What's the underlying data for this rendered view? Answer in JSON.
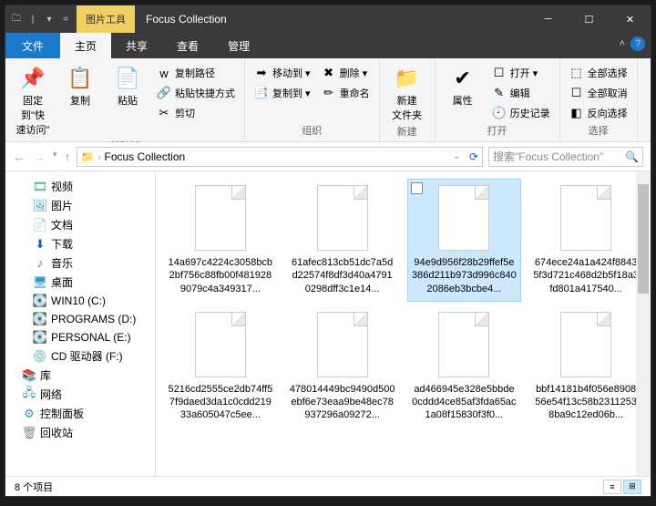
{
  "titlebar": {
    "contextual_label": "图片工具",
    "title": "Focus Collection"
  },
  "tabs": {
    "file": "文件",
    "items": [
      "主页",
      "共享",
      "查看",
      "管理"
    ],
    "active": 0
  },
  "ribbon": {
    "groups": [
      {
        "label": "剪贴板",
        "big": [
          {
            "label": "固定到\"快\n速访问\"",
            "icon": "📌"
          },
          {
            "label": "复制",
            "icon": "📋"
          },
          {
            "label": "粘贴",
            "icon": "📄"
          }
        ],
        "small": [
          {
            "label": "复制路径",
            "icon": "w"
          },
          {
            "label": "粘贴快捷方式",
            "icon": "🔗"
          },
          {
            "label": "剪切",
            "icon": "✂"
          }
        ]
      },
      {
        "label": "组织",
        "small": [
          {
            "label": "移动到 ▾",
            "icon": "➡"
          },
          {
            "label": "复制到 ▾",
            "icon": "📑"
          }
        ],
        "small2": [
          {
            "label": "删除 ▾",
            "icon": "✖"
          },
          {
            "label": "重命名",
            "icon": "✏"
          }
        ]
      },
      {
        "label": "新建",
        "big": [
          {
            "label": "新建\n文件夹",
            "icon": "📁"
          }
        ]
      },
      {
        "label": "打开",
        "big": [
          {
            "label": "属性",
            "icon": "✔"
          }
        ],
        "small": [
          {
            "label": "打开 ▾",
            "icon": "☐"
          },
          {
            "label": "编辑",
            "icon": "✎"
          },
          {
            "label": "历史记录",
            "icon": "🕘"
          }
        ]
      },
      {
        "label": "选择",
        "small": [
          {
            "label": "全部选择",
            "icon": "⬚"
          },
          {
            "label": "全部取消",
            "icon": "☐"
          },
          {
            "label": "反向选择",
            "icon": "◧"
          }
        ]
      }
    ]
  },
  "addressbar": {
    "path": "Focus Collection",
    "search_placeholder": "搜索\"Focus Collection\""
  },
  "sidebar": [
    {
      "label": "视频",
      "icon": "🎞",
      "color": "#4a8"
    },
    {
      "label": "图片",
      "icon": "🖼",
      "color": "#39c"
    },
    {
      "label": "文档",
      "icon": "📄",
      "color": "#888"
    },
    {
      "label": "下载",
      "icon": "⬇",
      "color": "#06c"
    },
    {
      "label": "音乐",
      "icon": "♪",
      "color": "#09c"
    },
    {
      "label": "桌面",
      "icon": "🖥",
      "color": "#39c"
    },
    {
      "label": "WIN10 (C:)",
      "icon": "💽",
      "color": "#888"
    },
    {
      "label": "PROGRAMS (D:)",
      "icon": "💽",
      "color": "#888"
    },
    {
      "label": "PERSONAL (E:)",
      "icon": "💽",
      "color": "#888"
    },
    {
      "label": "CD 驱动器 (F:)",
      "icon": "💿",
      "color": "#888"
    },
    {
      "label": "库",
      "icon": "📚",
      "color": "#e9a23b",
      "l1": true
    },
    {
      "label": "网络",
      "icon": "🖧",
      "color": "#39c",
      "l1": true
    },
    {
      "label": "控制面板",
      "icon": "⚙",
      "color": "#39c",
      "l1": true
    },
    {
      "label": "回收站",
      "icon": "🗑",
      "color": "#888",
      "l1": true
    }
  ],
  "files": [
    {
      "name": "14a697c4224c3058bcb2bf756c88fb00f4819289079c4a349317..."
    },
    {
      "name": "61afec813cb51dc7a5dd22574f8df3d40a47910298dff3c1e14..."
    },
    {
      "name": "94e9d956f28b29ffef5e386d211b973d996c8402086eb3bcbe4...",
      "selected": true
    },
    {
      "name": "674ece24a1a424f88435f3d721c468d2b5f18a3fd801a417540..."
    },
    {
      "name": "5216cd2555ce2db74ff57f9daed3da1c0cdd21933a605047c5ee..."
    },
    {
      "name": "478014449bc9490d500ebf6e73eaa9be48ec78937296a09272..."
    },
    {
      "name": "ad466945e328e5bbde0cddd4ce85af3fda65ac1a08f15830f3f0..."
    },
    {
      "name": "bbf14181b4f056e890856e54f13c58b23112538ba9c12ed06b..."
    }
  ],
  "status": {
    "count": "8 个项目"
  }
}
